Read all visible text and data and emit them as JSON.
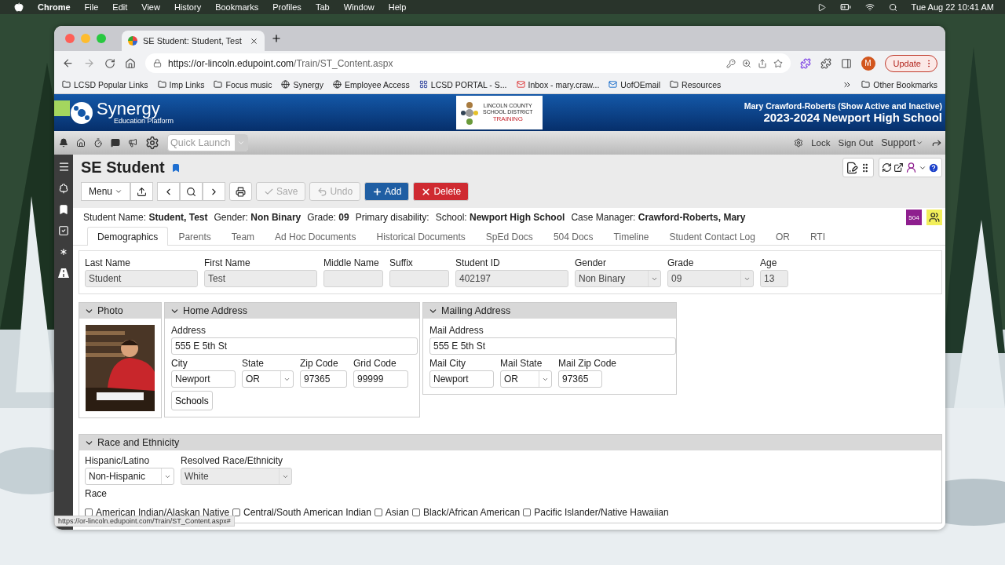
{
  "menubar": {
    "app": "Chrome",
    "menus": [
      "File",
      "Edit",
      "View",
      "History",
      "Bookmarks",
      "Profiles",
      "Tab",
      "Window",
      "Help"
    ],
    "clock": "Tue Aug 22  10:41 AM"
  },
  "browser": {
    "tab_title": "SE Student: Student, Test",
    "url_host": "https://or-lincoln.edupoint.com",
    "url_path": "/Train/ST_Content.aspx",
    "profile_initial": "M",
    "update_label": "Update",
    "bookmarks": [
      {
        "label": "LCSD Popular Links",
        "kind": "folder"
      },
      {
        "label": "Imp Links",
        "kind": "folder"
      },
      {
        "label": "Focus music",
        "kind": "folder"
      },
      {
        "label": "Synergy",
        "kind": "site"
      },
      {
        "label": "Employee Access",
        "kind": "site"
      },
      {
        "label": "LCSD PORTAL - S...",
        "kind": "portal"
      },
      {
        "label": "Inbox - mary.craw...",
        "kind": "mail"
      },
      {
        "label": "UofOEmail",
        "kind": "outlook"
      },
      {
        "label": "Resources",
        "kind": "folder"
      }
    ],
    "other_bookmarks": "Other Bookmarks",
    "status_url": "https://or-lincoln.edupoint.com/Train/ST_Content.aspx#"
  },
  "header": {
    "brand": "Synergy",
    "brand_sub": "Education Platform",
    "district_lines": [
      "LINCOLN COUNTY",
      "SCHOOL DISTRICT"
    ],
    "district_tag": "TRAINING",
    "user": "Mary Crawford-Roberts (Show Active and Inactive)",
    "school_year": "2023-2024 Newport High School"
  },
  "topbar": {
    "quick_launch_placeholder": "Quick Launch",
    "links": [
      "Lock",
      "Sign Out"
    ],
    "support": "Support"
  },
  "page": {
    "title": "SE Student",
    "badge": "504"
  },
  "toolbar": [
    {
      "kind": "menu",
      "label": "Menu",
      "disabled": false
    },
    {
      "kind": "save",
      "label": "Save",
      "disabled": true
    },
    {
      "kind": "undo",
      "label": "Undo",
      "disabled": true
    },
    {
      "kind": "add",
      "label": "Add",
      "disabled": false
    },
    {
      "kind": "delete",
      "label": "Delete",
      "disabled": false
    }
  ],
  "summary": [
    {
      "label": "Student Name:",
      "value": "Student, Test"
    },
    {
      "label": "Gender:",
      "value": "Non Binary"
    },
    {
      "label": "Grade:",
      "value": "09"
    },
    {
      "label": "Primary disability:"
    },
    {
      "label": "School:",
      "value": "Newport High School"
    },
    {
      "label": "Case Manager:",
      "value": "Crawford-Roberts, Mary"
    }
  ],
  "tabs": [
    {
      "label": "Demographics",
      "selected": true
    },
    {
      "label": "Parents",
      "selected": false
    },
    {
      "label": "Team",
      "selected": false
    },
    {
      "label": "Ad Hoc Documents",
      "selected": false
    },
    {
      "label": "Historical Documents",
      "selected": false
    },
    {
      "label": "SpEd Docs",
      "selected": false
    },
    {
      "label": "504 Docs",
      "selected": false
    },
    {
      "label": "Timeline",
      "selected": false
    },
    {
      "label": "Student Contact Log",
      "selected": false
    },
    {
      "label": "OR",
      "selected": false
    },
    {
      "label": "RTI",
      "selected": false
    }
  ],
  "student_fields": [
    {
      "label": "Last Name",
      "value": "Student",
      "kind": "text",
      "disabled": true
    },
    {
      "label": "First Name",
      "value": "Test",
      "kind": "text",
      "disabled": true
    },
    {
      "label": "Middle Name",
      "kind": "text",
      "disabled": true
    },
    {
      "label": "Suffix",
      "kind": "text",
      "disabled": true
    },
    {
      "label": "Student ID",
      "value": "402197",
      "kind": "text",
      "disabled": true
    },
    {
      "label": "Gender",
      "value": "Non Binary",
      "kind": "select",
      "disabled": true
    },
    {
      "label": "Grade",
      "value": "09",
      "kind": "select",
      "disabled": true
    },
    {
      "label": "Age",
      "value": "13",
      "kind": "text",
      "disabled": true
    }
  ],
  "photo_section": {
    "title": "Photo",
    "expanded": true
  },
  "home_address": {
    "title": "Home Address",
    "expanded": true,
    "rows": [
      [
        {
          "label": "Address",
          "value": "555 E 5th St",
          "kind": "text",
          "disabled": false
        }
      ],
      [
        {
          "label": "City",
          "value": "Newport",
          "kind": "text",
          "disabled": false
        },
        {
          "label": "State",
          "value": "OR",
          "kind": "select",
          "disabled": false
        },
        {
          "label": "Zip Code",
          "value": "97365",
          "kind": "text",
          "disabled": false
        },
        {
          "label": "Grid Code",
          "value": "99999",
          "kind": "text",
          "disabled": false
        }
      ]
    ],
    "button": "Schools"
  },
  "mailing_address": {
    "title": "Mailing Address",
    "expanded": true,
    "rows": [
      [
        {
          "label": "Mail Address",
          "value": "555 E 5th St",
          "kind": "text",
          "disabled": false
        }
      ],
      [
        {
          "label": "Mail City",
          "value": "Newport",
          "kind": "text",
          "disabled": false
        },
        {
          "label": "Mail State",
          "value": "OR",
          "kind": "select",
          "disabled": false
        },
        {
          "label": "Mail Zip Code",
          "value": "97365",
          "kind": "text",
          "disabled": false
        }
      ]
    ]
  },
  "race_section": {
    "title": "Race and Ethnicity",
    "expanded": true,
    "fields": [
      {
        "label": "Hispanic/Latino",
        "value": "Non-Hispanic",
        "kind": "select",
        "disabled": false
      },
      {
        "label": "Resolved Race/Ethnicity",
        "value": "White",
        "kind": "select",
        "disabled": true
      }
    ],
    "race_label": "Race",
    "races": [
      {
        "label": "American Indian/Alaskan Native",
        "checked": false
      },
      {
        "label": "Central/South American Indian",
        "checked": false
      },
      {
        "label": "Asian",
        "checked": false
      },
      {
        "label": "Black/African American",
        "checked": false
      },
      {
        "label": "Pacific Islander/Native Hawaiian",
        "checked": false
      }
    ]
  }
}
